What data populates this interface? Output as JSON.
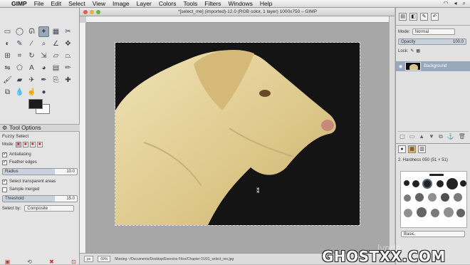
{
  "menubar": {
    "app": "GIMP",
    "items": [
      "File",
      "Edit",
      "Select",
      "View",
      "Image",
      "Layer",
      "Colors",
      "Tools",
      "Filters",
      "Windows",
      "Help"
    ]
  },
  "window": {
    "title": "*[select_me] (imported)-12.0 (RGB color, 1 layer) 1000x750 – GIMP"
  },
  "tool_options": {
    "tab_label": "Tool Options",
    "tool_name": "Fuzzy Select",
    "mode_label": "Mode:",
    "antialiasing": "Antialiasing",
    "feather_edges": "Feather edges",
    "radius_label": "Radius",
    "radius_value": "10.0",
    "select_transparent": "Select transparent areas",
    "sample_merged": "Sample merged",
    "threshold_label": "Threshold",
    "threshold_value": "15.0",
    "select_by_label": "Select by:",
    "select_by_value": "Composite"
  },
  "statusbar": {
    "unit": "px",
    "zoom": "69%",
    "message": "Missing ~/Documents/Desktop/Exercise Files/Chapter 01/01_select_me.jpg"
  },
  "layers": {
    "mode_label": "Mode:",
    "mode_value": "Normal",
    "opacity_label": "Opacity",
    "opacity_value": "100.0",
    "lock_label": "Lock:",
    "layer_name": "Background"
  },
  "brushes": {
    "brush_name": "2. Hardness 050 (51 × 51)",
    "tag_value": "Basic."
  },
  "watermark": {
    "text": "GHOSTXX.COM",
    "lynda": "lynda"
  },
  "colors": {
    "foreground": "#1b1b1b",
    "background": "#ffffff",
    "selection": "#98a8bd"
  }
}
